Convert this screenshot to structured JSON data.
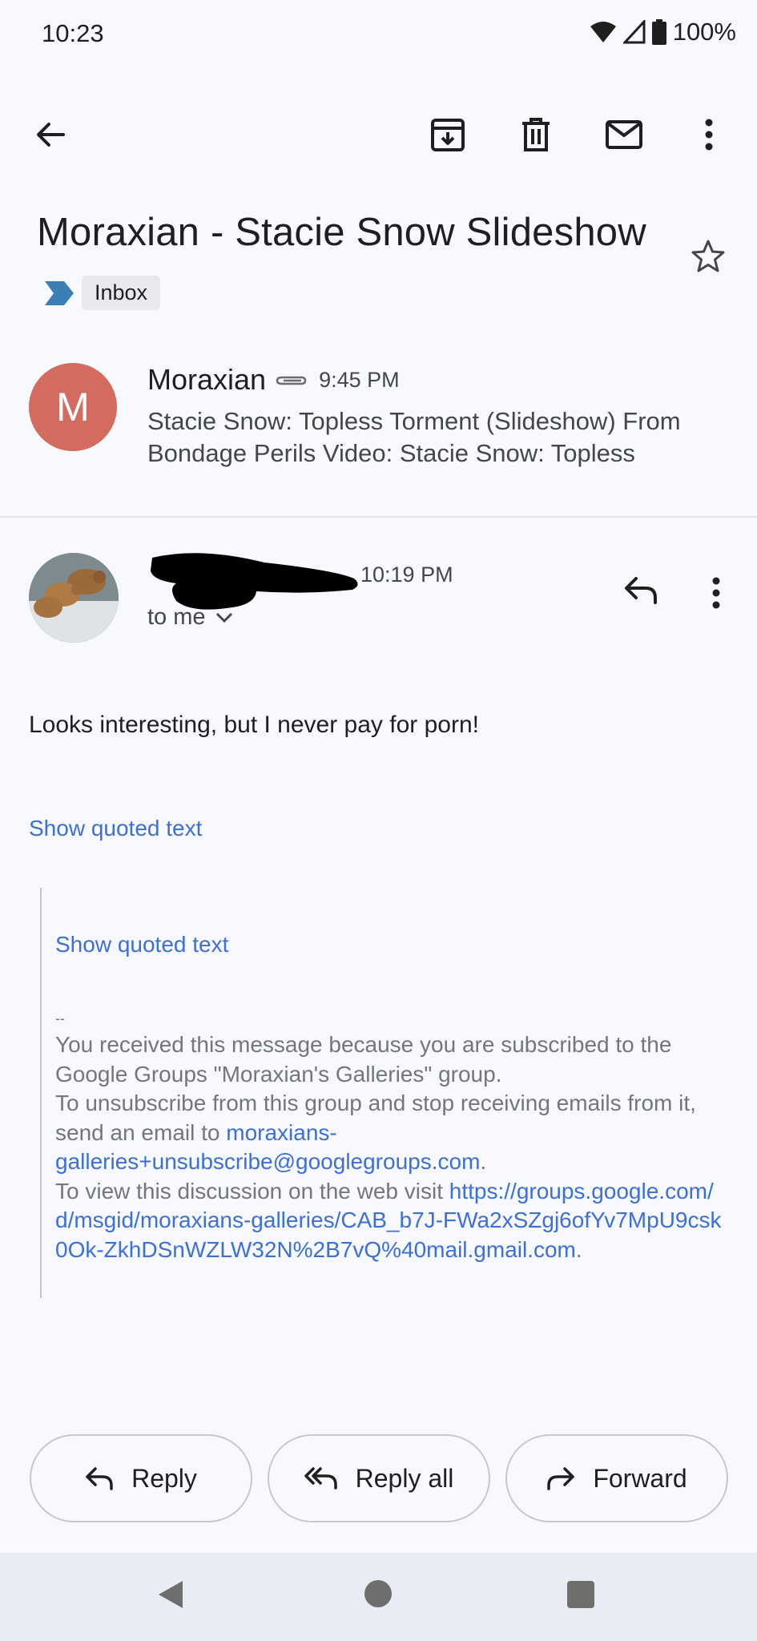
{
  "status_bar": {
    "time": "10:23",
    "battery": "100%"
  },
  "toolbar": {
    "back_icon": "arrow-left-icon",
    "archive_icon": "archive-icon",
    "delete_icon": "trash-icon",
    "mark_unread_icon": "envelope-icon",
    "more_icon": "more-vertical-icon"
  },
  "email": {
    "subject": "Moraxian - Stacie Snow Slideshow",
    "label": "Inbox",
    "messages": [
      {
        "avatar_letter": "M",
        "avatar_color": "#d36b5e",
        "sender": "Moraxian",
        "has_attachment": true,
        "time": "9:45 PM",
        "snippet": "Stacie Snow: Topless Torment (Slideshow) From Bondage Perils Video: Stacie Snow: Topless"
      },
      {
        "time": "10:19 PM",
        "recipient": "to me",
        "body": "Looks interesting, but I never pay for porn!",
        "show_quoted_text": "Show quoted text",
        "quoted": {
          "show_quoted_text": "Show quoted text",
          "separator": "--",
          "line1": "You received this message because you are subscribed to the Google Groups \"Moraxian's Galleries\" group.",
          "line2_prefix": "To unsubscribe from this group and stop receiving emails from it, send an email to ",
          "unsubscribe_email": "moraxians-galleries+unsubscribe@googlegroups.com",
          "line2_suffix": ".",
          "line3_prefix": "To view this discussion on the web visit ",
          "discussion_url": "https://groups.google.com/d/msgid/moraxians-galleries/CAB_b7J-FWa2xSZgj6ofYv7MpU9csk0Ok-ZkhDSnWZLW32N%2B7vQ%40mail.gmail.com",
          "line3_suffix": "."
        }
      }
    ]
  },
  "actions": {
    "reply": "Reply",
    "reply_all": "Reply all",
    "forward": "Forward"
  },
  "colors": {
    "accent_link": "#3d6fd8",
    "background": "#f8f9fe",
    "label_marker": "#3b7fb5"
  }
}
